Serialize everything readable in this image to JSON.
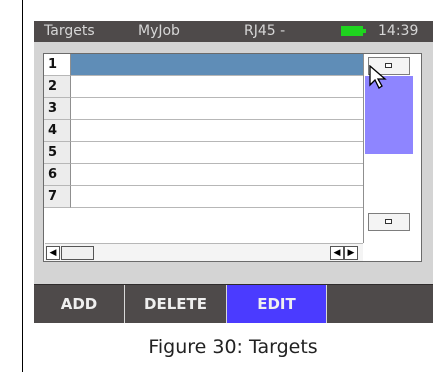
{
  "status_bar": {
    "title": "Targets",
    "job": "MyJob",
    "port": "RJ45 -",
    "battery_icon": "battery-full-icon",
    "battery_color": "#1fd41f",
    "time": "14:39"
  },
  "grid": {
    "rows": [
      {
        "number": "1",
        "value": "",
        "selected": true
      },
      {
        "number": "2",
        "value": "",
        "selected": false
      },
      {
        "number": "3",
        "value": "",
        "selected": false
      },
      {
        "number": "4",
        "value": "",
        "selected": false
      },
      {
        "number": "5",
        "value": "",
        "selected": false
      },
      {
        "number": "6",
        "value": "",
        "selected": false
      },
      {
        "number": "7",
        "value": "",
        "selected": false
      }
    ],
    "selection_color": "#5f8db7",
    "scrollbar_thumb_color": "#8e85ff",
    "left_arrow": "◀",
    "right_arrow": "▶"
  },
  "toolbar": {
    "add": "ADD",
    "delete": "DELETE",
    "edit": "EDIT",
    "active_color": "#4b3bff"
  },
  "caption": "Figure 30: Targets"
}
